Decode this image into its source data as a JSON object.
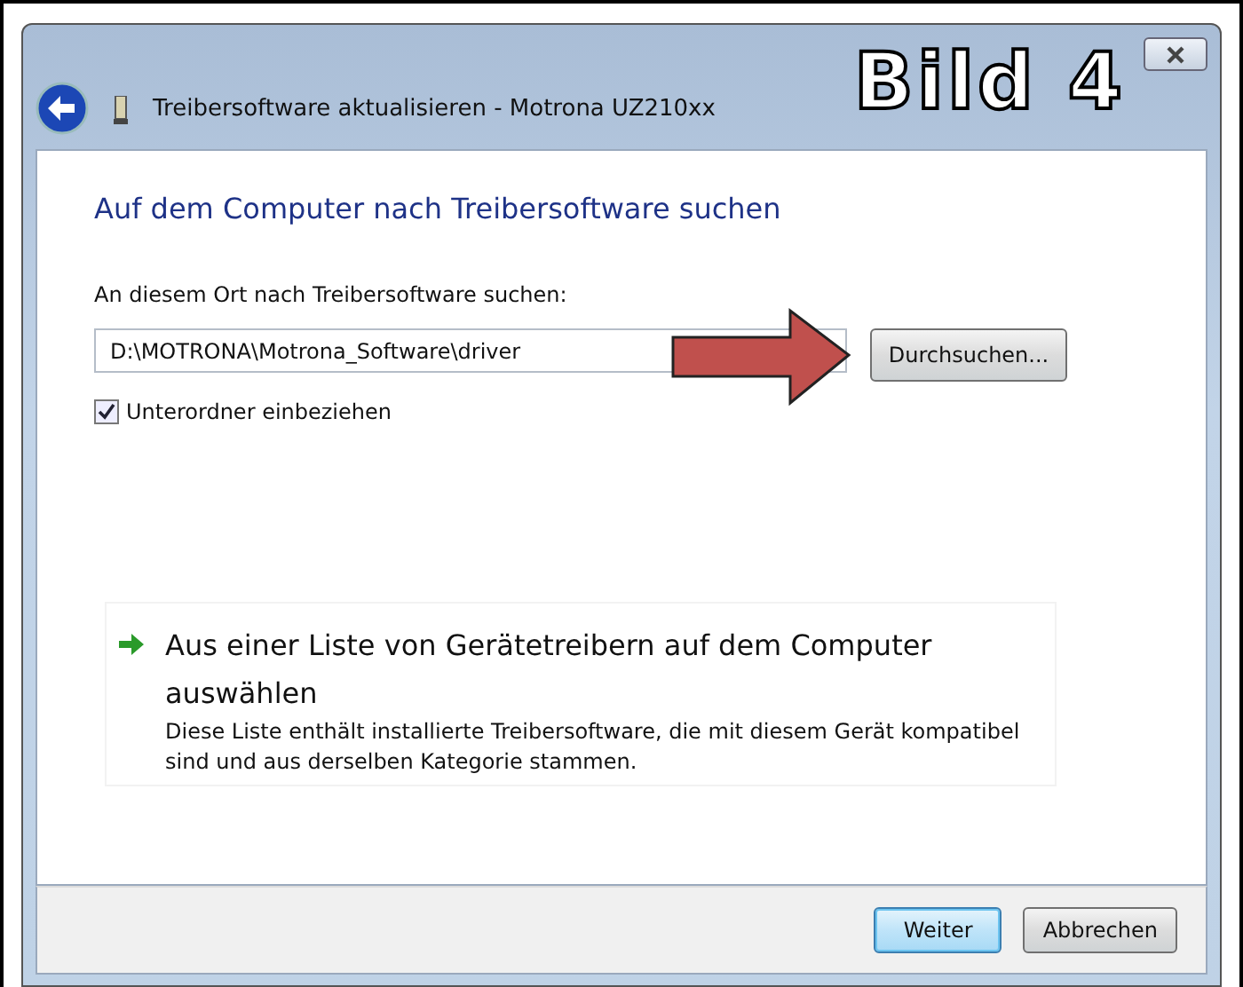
{
  "annotation": {
    "label": "Bild 4"
  },
  "window": {
    "title": "Treibersoftware aktualisieren - Motrona UZ210xx"
  },
  "heading": "Auf dem Computer nach Treibersoftware suchen",
  "location": {
    "label": "An diesem Ort nach Treibersoftware suchen:",
    "value": "D:\\MOTRONA\\Motrona_Software\\driver",
    "browse_button": "Durchsuchen..."
  },
  "subfolders": {
    "label": "Unterordner einbeziehen",
    "checked": true
  },
  "option": {
    "title": "Aus einer Liste von Gerätetreibern auf dem Computer auswählen",
    "description": "Diese Liste enthält installierte Treibersoftware, die mit diesem Gerät kompatibel sind und aus derselben Kategorie stammen."
  },
  "buttons": [
    {
      "label": "Weiter",
      "default": true
    },
    {
      "label": "Abbrechen",
      "default": false
    }
  ]
}
